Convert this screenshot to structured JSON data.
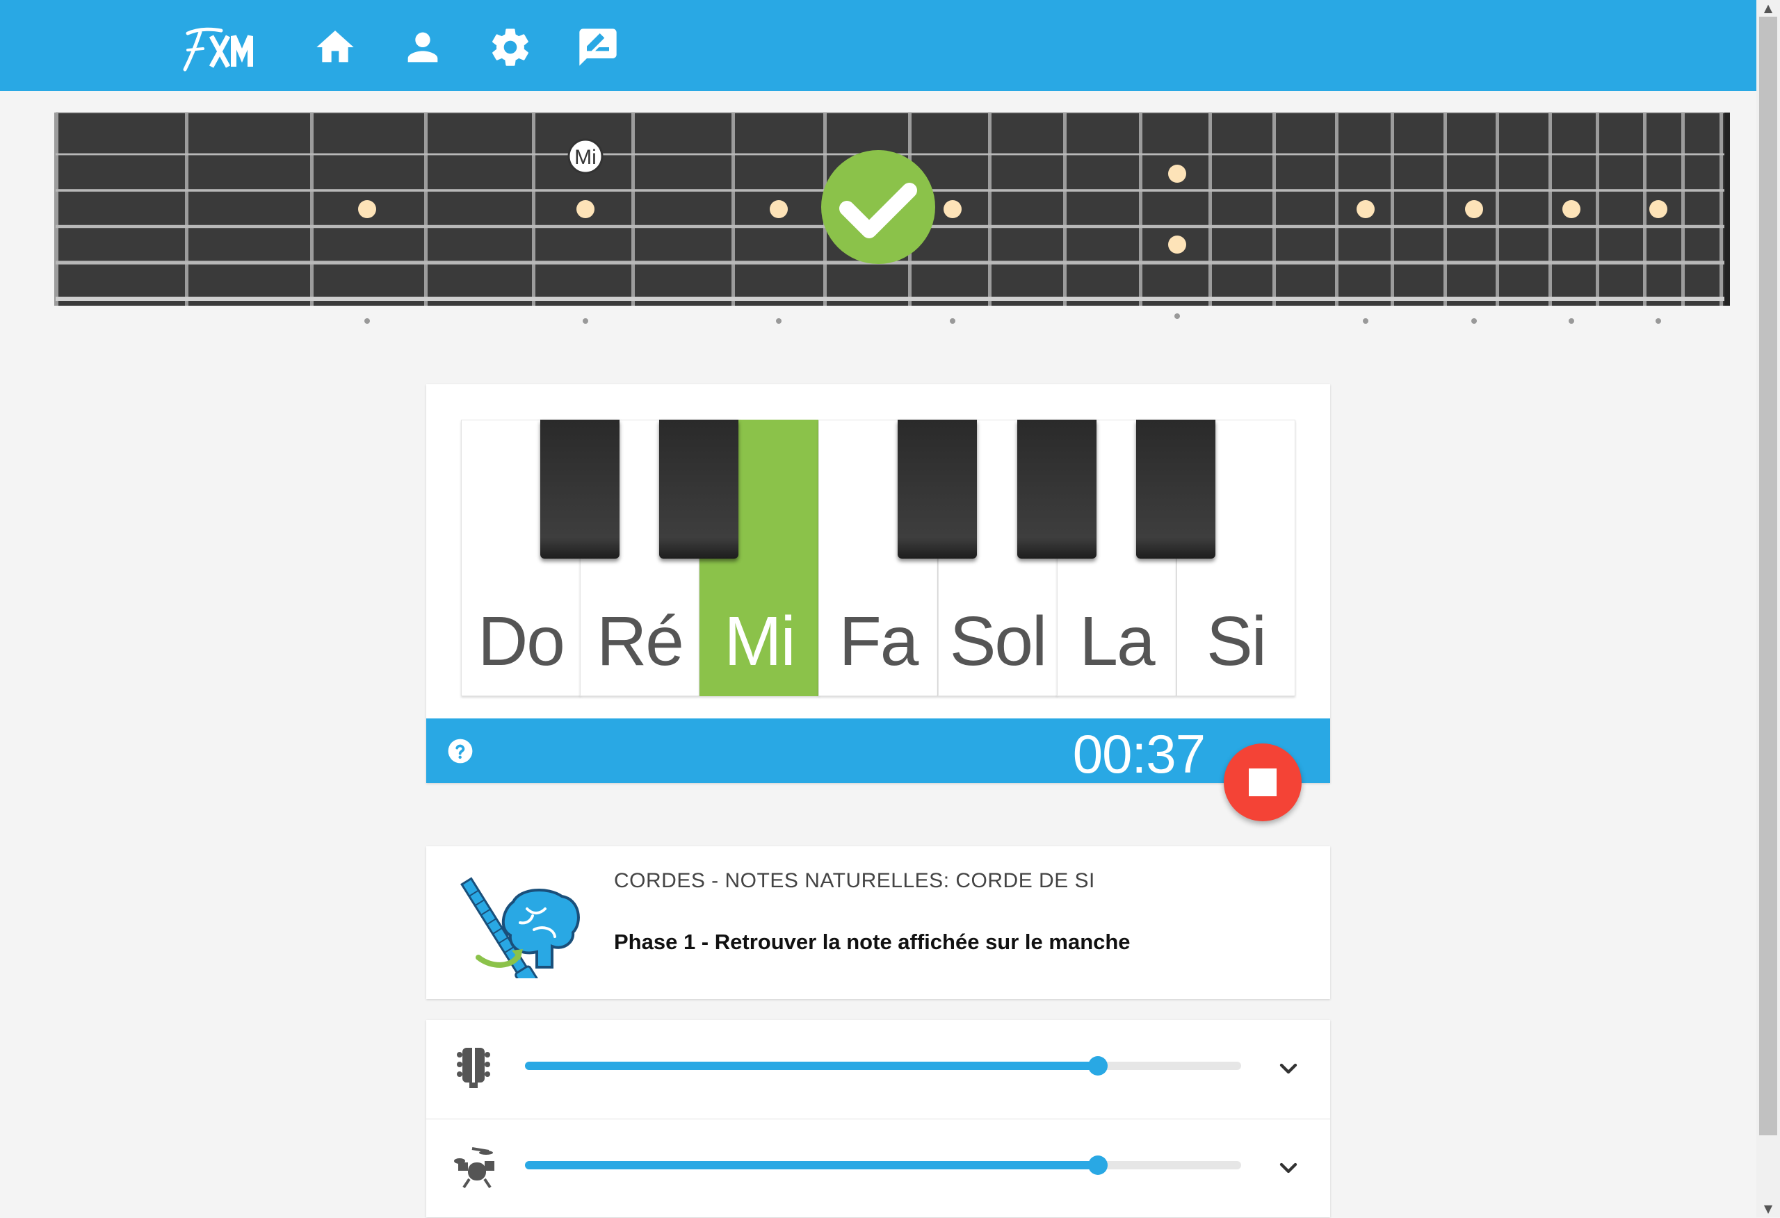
{
  "header": {
    "logo_text": "FXM",
    "nav": [
      {
        "name": "home"
      },
      {
        "name": "profile"
      },
      {
        "name": "settings"
      },
      {
        "name": "feedback"
      }
    ],
    "bar_color": "#29a8e4"
  },
  "fretboard": {
    "highlighted_note": "Mi",
    "result": "correct",
    "result_color": "#8bc24a"
  },
  "keyboard": {
    "white_keys": [
      "Do",
      "Ré",
      "Mi",
      "Fa",
      "Sol",
      "La",
      "Si"
    ],
    "active_key": "Mi",
    "active_color": "#8bc24a"
  },
  "timer": {
    "value": "00:37",
    "stop_color": "#f44336"
  },
  "exercise": {
    "title": "CORDES - NOTES NATURELLES: CORDE DE SI",
    "subtitle": "Phase 1 - Retrouver la note affichée sur le manche"
  },
  "volumes": [
    {
      "icon": "guitar-icon",
      "level": 0.8
    },
    {
      "icon": "drums-icon",
      "level": 0.8
    }
  ]
}
